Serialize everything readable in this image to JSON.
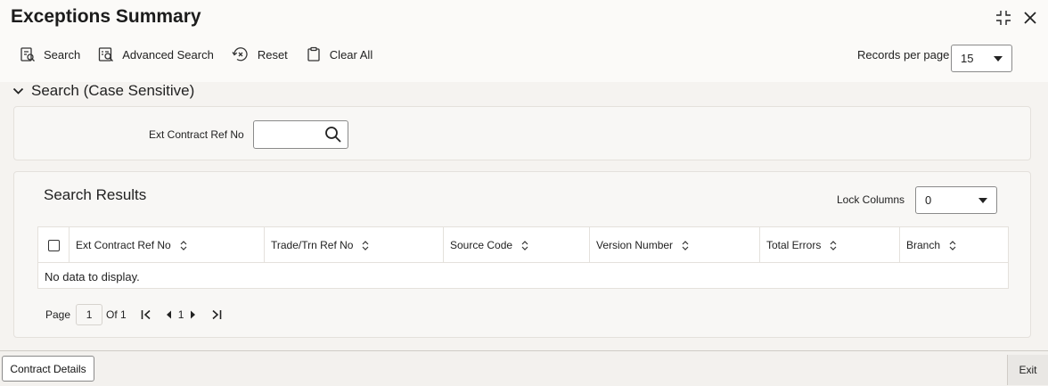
{
  "window": {
    "title": "Exceptions Summary",
    "controls": [
      {
        "name": "minimize-icon",
        "symbol": "collapse"
      },
      {
        "name": "close-icon",
        "symbol": "×"
      }
    ]
  },
  "toolbar": {
    "search_label": "Search",
    "advanced_search_label": "Advanced Search",
    "reset_label": "Reset",
    "clear_all_label": "Clear All",
    "records_per_page_label": "Records per page",
    "records_per_page_value": "15"
  },
  "search_section": {
    "title": "Search (Case Sensitive)",
    "fields": {
      "ext_contract_ref_no_label": "Ext Contract Ref No",
      "ext_contract_ref_no_value": ""
    }
  },
  "results": {
    "title": "Search Results",
    "lock_columns_label": "Lock Columns",
    "lock_columns_value": "0",
    "columns": [
      "Ext Contract Ref No",
      "Trade/Trn Ref No",
      "Source Code",
      "Version Number",
      "Total Errors",
      "Branch"
    ],
    "rows": [],
    "empty_message": "No data to display."
  },
  "pagination": {
    "page_label": "Page",
    "current_page": "1",
    "of_label": "Of 1",
    "page_number": "1"
  },
  "footer": {
    "contract_details_label": "Contract Details",
    "exit_label": "Exit"
  }
}
